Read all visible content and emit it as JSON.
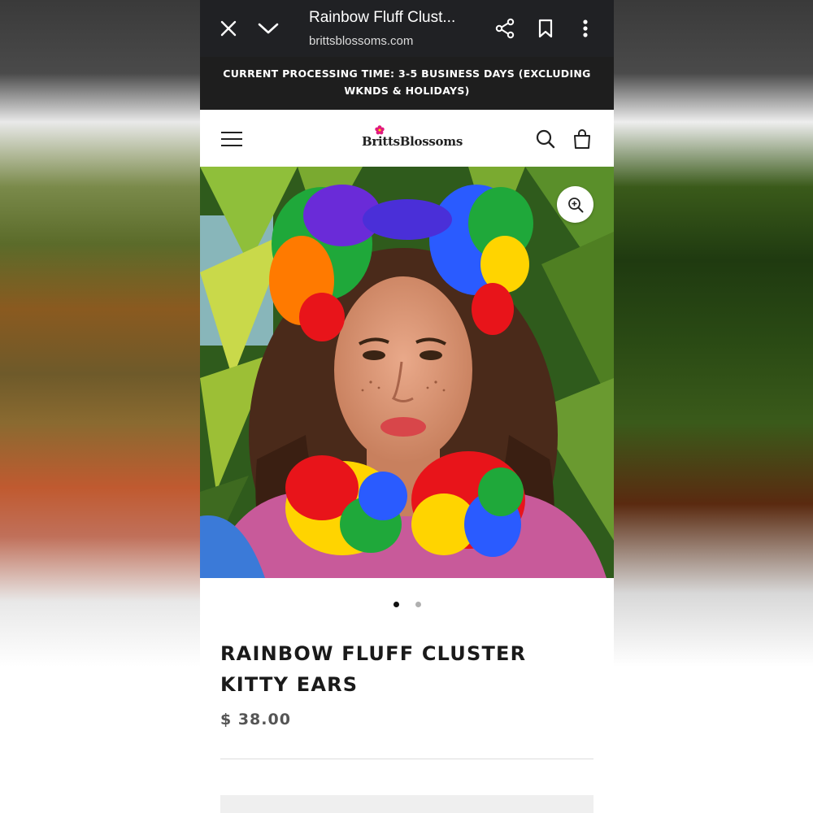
{
  "browser": {
    "title": "Rainbow Fluff Clust...",
    "url": "brittsblossoms.com",
    "icons": [
      "close-icon",
      "chevron-down-icon",
      "share-icon",
      "bookmark-icon",
      "more-vert-icon"
    ]
  },
  "announcement": {
    "text": "CURRENT PROCESSING TIME: 3-5 BUSINESS DAYS (EXCLUDING WKNDS & HOLIDAYS)"
  },
  "header": {
    "logo": "BrittsBlossoms",
    "icons": [
      "menu-icon",
      "search-icon",
      "cart-icon"
    ]
  },
  "product": {
    "image_alt_colors": [
      "#1fa83a",
      "#ffd400",
      "#ff7a00",
      "#e8141a",
      "#2a5bff",
      "#6a2bd8"
    ],
    "carousel": {
      "count": 2,
      "active": 1
    },
    "title": "RAINBOW FLUFF CLUSTER KITTY EARS",
    "price": "$ 38.00"
  },
  "colors": {
    "browser_bar": "#202124",
    "announcement_bg": "#1e1e1e",
    "logo_flower": "#e0197d"
  }
}
